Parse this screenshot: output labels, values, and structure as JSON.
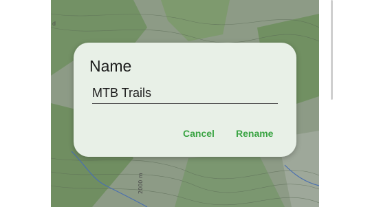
{
  "map": {
    "label_left": "d",
    "label_elevation": "2000 m"
  },
  "dialog": {
    "title": "Name",
    "input_value": "MTB Trails",
    "cancel_label": "Cancel",
    "rename_label": "Rename"
  },
  "colors": {
    "accent": "#3aa443",
    "dialog_bg": "#e8f0e7",
    "map_forest": "#6f8f5e"
  }
}
